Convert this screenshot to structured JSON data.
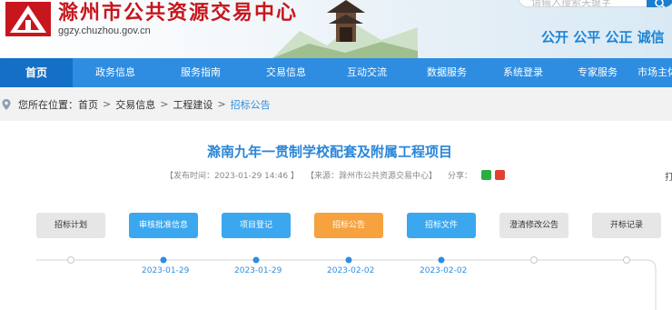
{
  "brand": {
    "title": "滁州市公共资源交易中心",
    "url": "ggzy.chuzhou.gov.cn",
    "slogan": "公开 公平 公正 诚信",
    "search_placeholder": "请输入搜索关键字"
  },
  "nav": {
    "items": [
      {
        "label": "首页",
        "active": true
      },
      {
        "label": "政务信息",
        "active": false
      },
      {
        "label": "服务指南",
        "active": false
      },
      {
        "label": "交易信息",
        "active": false
      },
      {
        "label": "互动交流",
        "active": false
      },
      {
        "label": "数据服务",
        "active": false
      },
      {
        "label": "系统登录",
        "active": false
      },
      {
        "label": "专家服务",
        "active": false
      },
      {
        "label": "市场主体",
        "active": false
      }
    ]
  },
  "breadcrumb": {
    "prefix": "您所在位置：",
    "items": [
      "首页",
      "交易信息",
      "工程建设",
      "招标公告"
    ],
    "sep": ">"
  },
  "article": {
    "title": "滁南九年一贯制学校配套及附属工程项目",
    "publish_time": "【发布时间：2023-01-29 14:46 】",
    "source": "【来源：滁州市公共资源交易中心】",
    "share_label": "分享：",
    "print_label": "打"
  },
  "flow": {
    "tabs": [
      {
        "label": "招标计划",
        "state": "gray"
      },
      {
        "label": "审核批准信息",
        "state": "blue"
      },
      {
        "label": "项目登记",
        "state": "blue"
      },
      {
        "label": "招标公告",
        "state": "orange"
      },
      {
        "label": "招标文件",
        "state": "blue"
      },
      {
        "label": "澄清修改公告",
        "state": "gray"
      },
      {
        "label": "开标记录",
        "state": "gray"
      }
    ],
    "dates": [
      "",
      "2023-01-29",
      "2023-01-29",
      "2023-02-02",
      "2023-02-02",
      "",
      ""
    ]
  },
  "colors": {
    "brand_red": "#c8161d",
    "nav_blue": "#2e8de0",
    "accent_orange": "#f6a23e",
    "tab_blue": "#3ba7ef"
  }
}
